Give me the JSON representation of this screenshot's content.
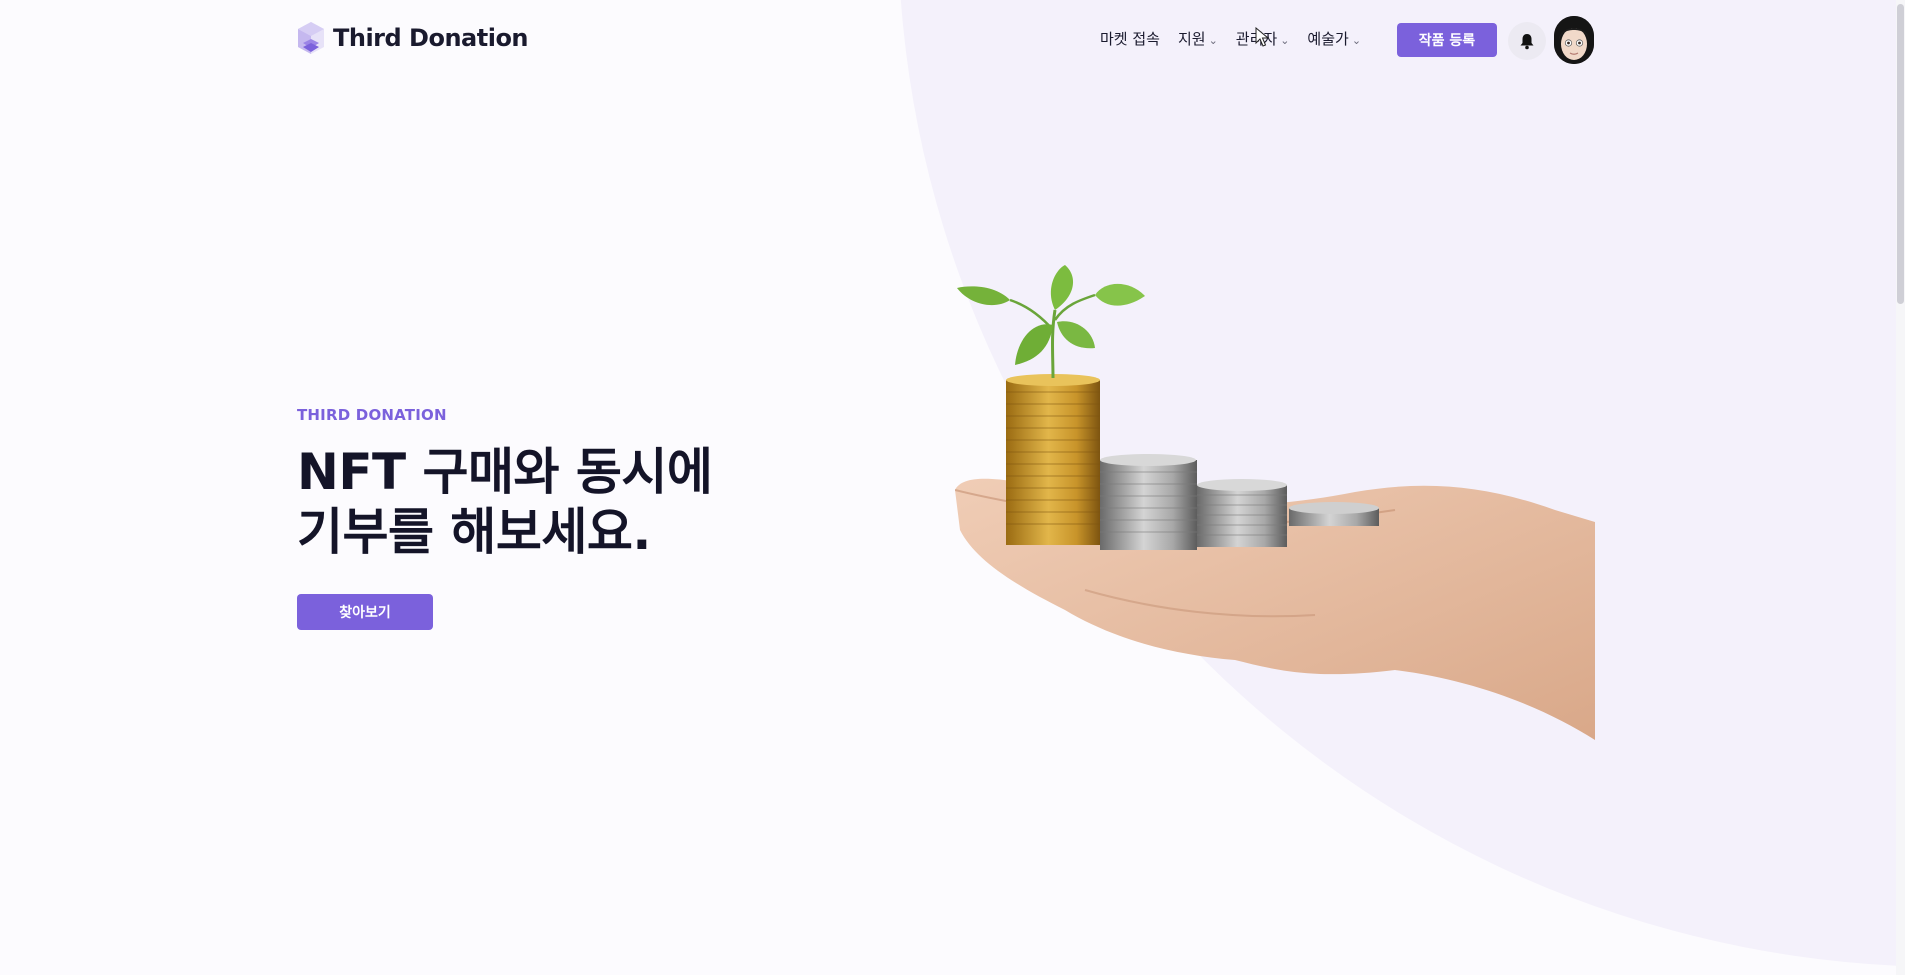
{
  "header": {
    "brand": "Third Donation",
    "nav": [
      {
        "label": "마켓 접속",
        "has_dropdown": false
      },
      {
        "label": "지원",
        "has_dropdown": true
      },
      {
        "label": "관리자",
        "has_dropdown": true
      },
      {
        "label": "예술가",
        "has_dropdown": true
      }
    ],
    "register_label": "작품 등록",
    "bell_icon": "bell-icon",
    "avatar_icon": "user-avatar"
  },
  "hero": {
    "eyebrow": "THIRD DONATION",
    "headline_line1": "NFT 구매와 동시에",
    "headline_line2": "기부를 해보세요.",
    "cta_label": "찾아보기",
    "image_icon": "hand-with-coins-and-sprout"
  },
  "colors": {
    "accent": "#7b61dc",
    "heading": "#141428",
    "background": "#fcfbfe",
    "blob": "#f4f1fb"
  }
}
